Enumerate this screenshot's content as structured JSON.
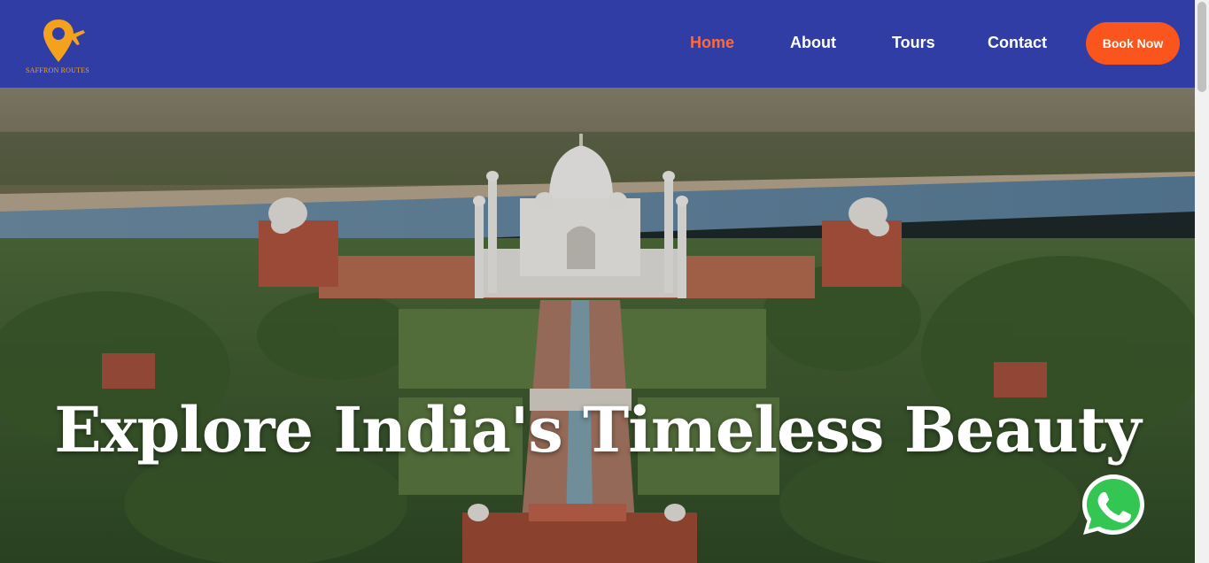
{
  "brand": {
    "name": "SAFFRON ROUTES",
    "logo_icon": "map-pin-airplane-icon"
  },
  "nav": {
    "items": [
      {
        "label": "Home",
        "active": true
      },
      {
        "label": "About",
        "active": false
      },
      {
        "label": "Tours",
        "active": false
      },
      {
        "label": "Contact",
        "active": false
      }
    ],
    "cta_label": "Book Now"
  },
  "hero": {
    "title": "Explore India's Timeless Beauty"
  },
  "whatsapp": {
    "icon": "whatsapp-icon"
  },
  "colors": {
    "header_bg": "#2f3da5",
    "accent": "#f9551c",
    "active_link": "#ff6a3d",
    "logo": "#f4a11d"
  }
}
